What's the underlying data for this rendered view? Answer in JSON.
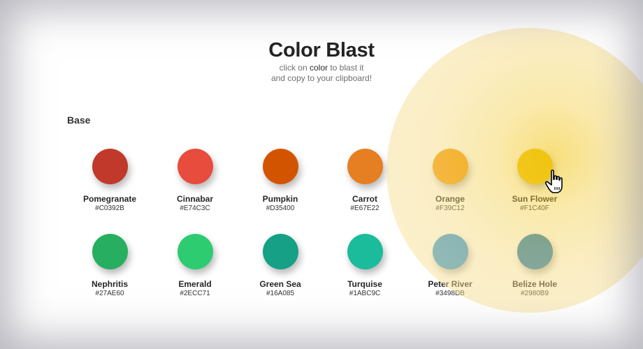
{
  "header": {
    "title": "Color Blast",
    "subtitle_pre": "click on",
    "subtitle_bold": "color",
    "subtitle_post": "to blast it",
    "subtitle_line2": "and copy to your clipboard!"
  },
  "section": {
    "label": "Base"
  },
  "swatches": [
    {
      "name": "Pomegranate",
      "hex": "#C0392B",
      "color": "#C0392B"
    },
    {
      "name": "Cinnabar",
      "hex": "#E74C3C",
      "color": "#E74C3C"
    },
    {
      "name": "Pumpkin",
      "hex": "#D35400",
      "color": "#D35400"
    },
    {
      "name": "Carrot",
      "hex": "#E67E22",
      "color": "#E67E22"
    },
    {
      "name": "Orange",
      "hex": "#F39C12",
      "color": "#F39C12"
    },
    {
      "name": "Sun Flower",
      "hex": "#F1C40F",
      "color": "#F1C40F"
    },
    {
      "name": "Nephritis",
      "hex": "#27AE60",
      "color": "#27AE60"
    },
    {
      "name": "Emerald",
      "hex": "#2ECC71",
      "color": "#2ECC71"
    },
    {
      "name": "Green Sea",
      "hex": "#16A085",
      "color": "#16A085"
    },
    {
      "name": "Turquise",
      "hex": "#1ABC9C",
      "color": "#1ABC9C"
    },
    {
      "name": "Peter River",
      "hex": "#3498DB",
      "color": "#3498DB"
    },
    {
      "name": "Belize Hole",
      "hex": "#2980B9",
      "color": "#2980B9"
    }
  ],
  "blast": {
    "color": "#F1C40F"
  },
  "cursor": {
    "icon": "hand-pointer-icon"
  }
}
